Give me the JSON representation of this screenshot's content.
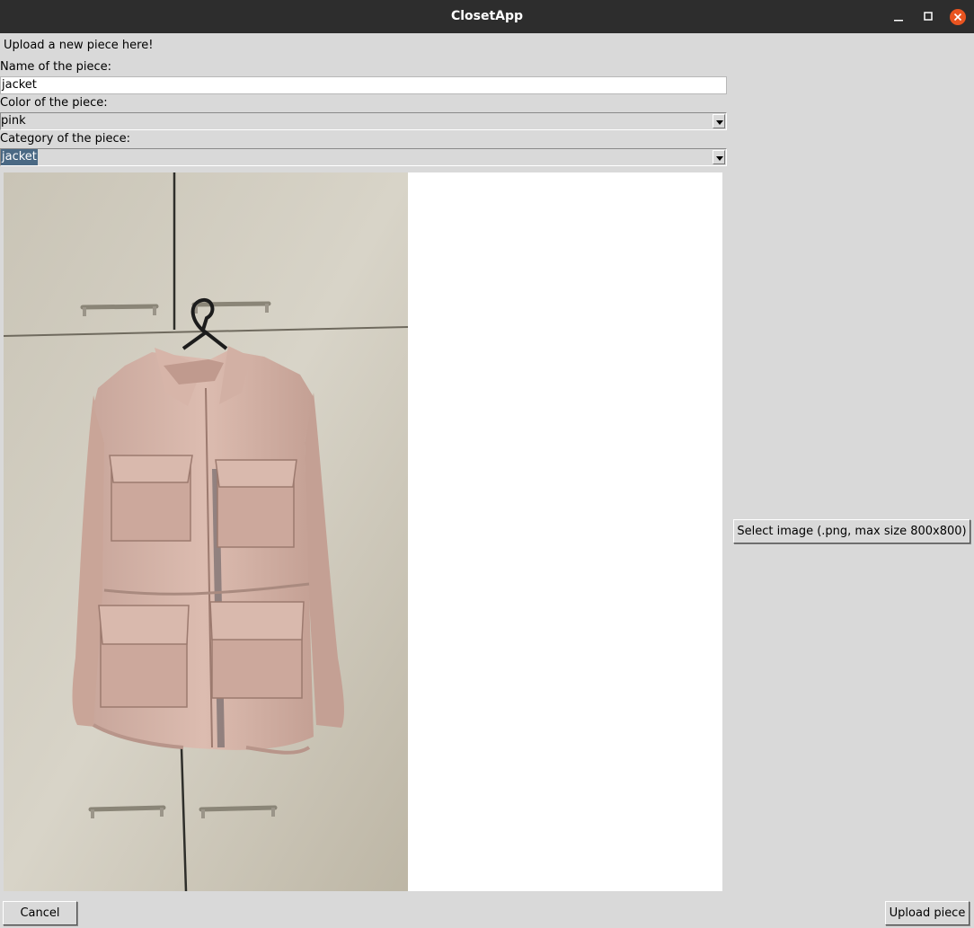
{
  "window": {
    "title": "ClosetApp",
    "controls": {
      "minimize": "minimize-icon",
      "maximize": "maximize-icon",
      "close": "close-icon"
    },
    "close_color": "#e95420"
  },
  "form": {
    "heading": "Upload a new piece here!",
    "name": {
      "label": "Name of the piece:",
      "value": "jacket"
    },
    "color": {
      "label": "Color of the piece:",
      "value": "pink"
    },
    "category": {
      "label": "Category of the piece:",
      "value": "jacket"
    }
  },
  "image_preview": {
    "content": "pink utility jacket on a black hanger in front of beige wardrobe doors"
  },
  "buttons": {
    "select_image": "Select image (.png, max size 800x800)",
    "cancel": "Cancel",
    "upload": "Upload piece"
  },
  "colors": {
    "selection": "#4a6984",
    "background": "#d9d9d9",
    "titlebar": "#2d2d2d"
  }
}
